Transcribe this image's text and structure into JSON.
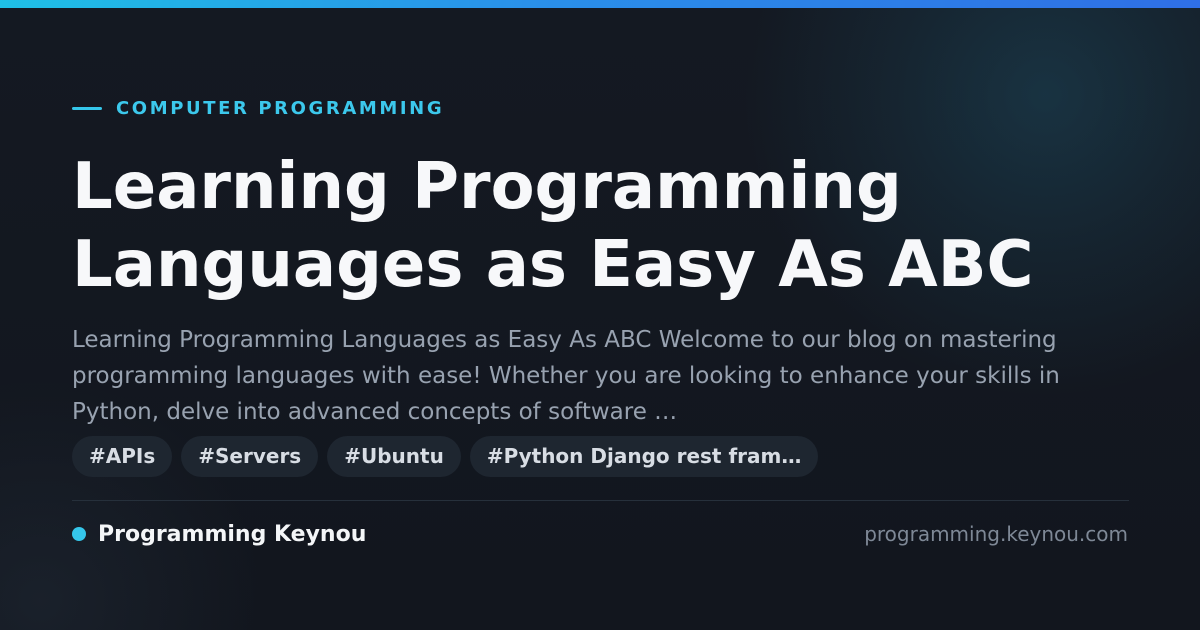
{
  "colors": {
    "accent": "#35c6ea",
    "background": "#12161f",
    "title": "#f7f8fa",
    "description": "#98a2b0",
    "tag_background": "#1e2630",
    "url": "#7e8896"
  },
  "category": {
    "label": "COMPUTER PROGRAMMING"
  },
  "article": {
    "title": "Learning Programming Languages as Easy As ABC",
    "description": "Learning Programming Languages as Easy As ABC Welcome to our blog on mastering programming languages with ease! Whether you are looking to enhance your skills in Python, delve into advanced concepts of software …"
  },
  "tags": [
    "#APIs",
    "#Servers",
    "#Ubuntu",
    "#Python Django rest fram…"
  ],
  "site": {
    "name": "Programming Keynou",
    "url": "programming.keynou.com"
  }
}
